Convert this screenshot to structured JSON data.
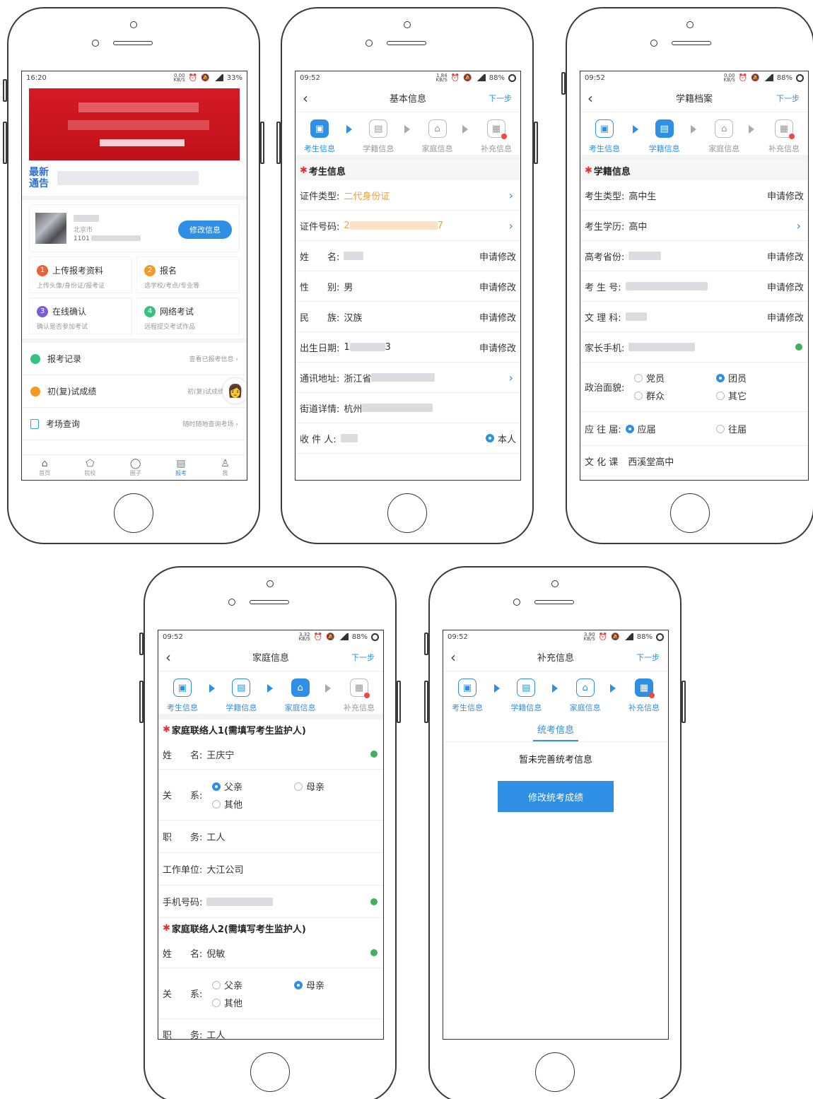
{
  "home": {
    "time": "16:20",
    "speed_top": "0.00",
    "speed_bottom": "KB/S",
    "battery": "33%",
    "notice_label_1": "最新",
    "notice_label_2": "通告",
    "profile_city": "北京市",
    "profile_id_prefix": "1101",
    "edit_button": "修改信息",
    "cards": [
      {
        "num": "1",
        "title": "上传报考资料",
        "sub": "上传头像/身份证/报考证",
        "color": "#f06030"
      },
      {
        "num": "2",
        "title": "报名",
        "sub": "选学校/考点/专业等",
        "color": "#f59a20"
      },
      {
        "num": "3",
        "title": "在线确认",
        "sub": "确认是否参加考试",
        "color": "#7b5cd6"
      },
      {
        "num": "4",
        "title": "网络考试",
        "sub": "远程提交考试作品",
        "color": "#38c080"
      }
    ],
    "list": [
      {
        "title": "报考记录",
        "right": "查看已报考信息",
        "icon": "record-icon",
        "color": "#38c080"
      },
      {
        "title": "初(复)试成绩",
        "right": "初(复)试成绩",
        "icon": "score-icon",
        "color": "#f59a20"
      },
      {
        "title": "考场查询",
        "right": "随时随地查询考场",
        "icon": "search-doc-icon",
        "color": "#38a0e0"
      }
    ],
    "tabs": [
      "首页",
      "院校",
      "圈子",
      "报考",
      "我"
    ]
  },
  "steps": [
    "考生信息",
    "学籍信息",
    "家庭信息",
    "补充信息"
  ],
  "basic": {
    "time": "09:52",
    "speed_top": "1.84",
    "speed_bottom": "KB/S",
    "battery": "88%",
    "title": "基本信息",
    "next": "下一步",
    "section": "考生信息",
    "rows": [
      {
        "label": "证件类型:",
        "value": "二代身份证"
      },
      {
        "label": "证件号码:",
        "value_start": "2",
        "value_end": "7"
      },
      {
        "label": "姓　　名:",
        "action": "申请修改"
      },
      {
        "label": "性　　别:",
        "value": "男",
        "action": "申请修改"
      },
      {
        "label": "民　　族:",
        "value": "汉族",
        "action": "申请修改"
      },
      {
        "label": "出生日期:",
        "value_start": "1",
        "value_end": "3",
        "action": "申请修改"
      },
      {
        "label": "通讯地址:",
        "value": "浙江省"
      },
      {
        "label": "街道详情:",
        "value": "杭州"
      },
      {
        "label": "收 件 人:",
        "action": "本人"
      }
    ]
  },
  "school": {
    "time": "09:52",
    "speed_top": "0.00",
    "speed_bottom": "KB/S",
    "battery": "88%",
    "title": "学籍档案",
    "next": "下一步",
    "section": "学籍信息",
    "rows": [
      {
        "label": "考生类型:",
        "value": "高中生",
        "action": "申请修改"
      },
      {
        "label": "考生学历:",
        "value": "高中"
      },
      {
        "label": "高考省份:",
        "action": "申请修改"
      },
      {
        "label": "考 生 号:",
        "action": "申请修改"
      },
      {
        "label": "文 理 科:",
        "action": "申请修改"
      },
      {
        "label": "家长手机:"
      }
    ],
    "political_label": "政治面貌:",
    "political_options": [
      "党员",
      "团员",
      "群众",
      "其它"
    ],
    "grad_label": "应 往 届:",
    "grad_options": [
      "应届",
      "往届"
    ],
    "culture_label": "文 化 课",
    "culture_value": "西溪堂高中"
  },
  "family": {
    "time": "09:52",
    "speed_top": "3.32",
    "speed_bottom": "KB/S",
    "battery": "88%",
    "title": "家庭信息",
    "next": "下一步",
    "section1": "家庭联络人1(需填写考生监护人)",
    "name_label": "姓　　名:",
    "name1": "王庆宁",
    "rel_label": "关　　系:",
    "rel_options": [
      "父亲",
      "母亲",
      "其他"
    ],
    "job_label": "职　　务:",
    "job1": "工人",
    "work_label": "工作单位:",
    "work1": "大江公司",
    "phone_label": "手机号码:",
    "section2": "家庭联络人2(需填写考生监护人)",
    "name2": "倪敏",
    "job2": "工人"
  },
  "extra": {
    "time": "09:52",
    "speed_top": "3.90",
    "speed_bottom": "KB/S",
    "battery": "88%",
    "title": "补充信息",
    "next": "下一步",
    "tab": "统考信息",
    "empty": "暂未完善统考信息",
    "button": "修改统考成绩"
  }
}
